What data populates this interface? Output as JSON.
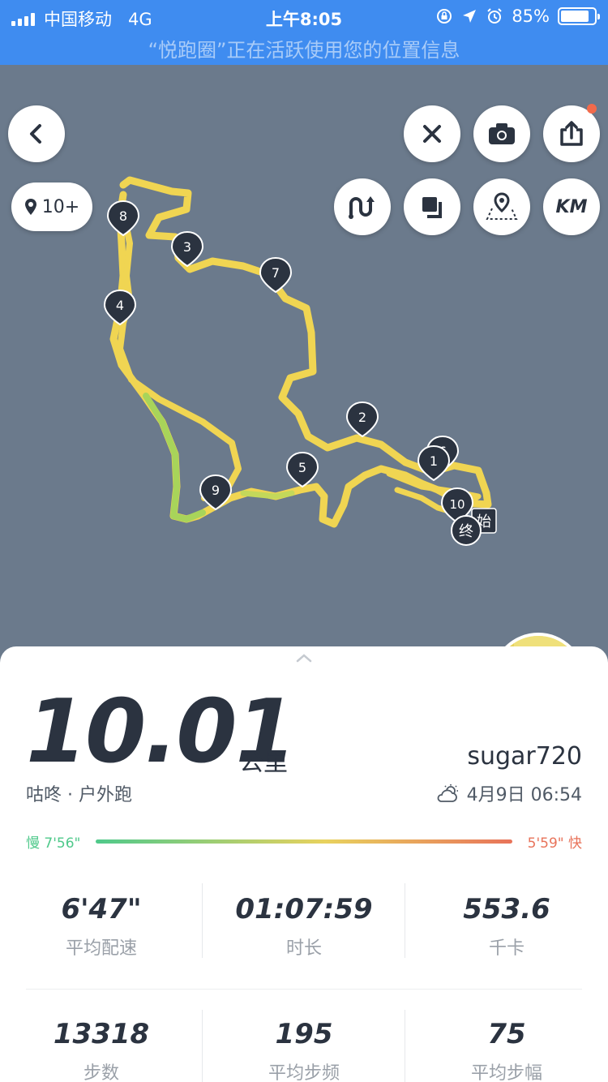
{
  "status_bar": {
    "carrier": "中国移动",
    "network": "4G",
    "time": "上午8:05",
    "battery": "85%",
    "battery_level": 0.85,
    "location_message": "“悦跑圈”正在活跃使用您的位置信息"
  },
  "map": {
    "location_count": "10+",
    "markers": [
      "1",
      "2",
      "3",
      "4",
      "5",
      "6",
      "7",
      "8",
      "9",
      "10"
    ],
    "start_label": "始",
    "end_label": "终",
    "unit_toggle": "KM"
  },
  "run": {
    "distance": "10.01",
    "unit": "公里",
    "source": "咕咚 · 户外跑",
    "username": "sugar720",
    "datetime": "4月9日 06:54"
  },
  "pace_bar": {
    "slow_label": "慢 7'56\"",
    "fast_label": "5'59\" 快"
  },
  "stats": [
    {
      "value": "6'47\"",
      "label": "平均配速"
    },
    {
      "value": "01:07:59",
      "label": "时长"
    },
    {
      "value": "553.6",
      "label": "千卡"
    },
    {
      "value": "13318",
      "label": "步数"
    },
    {
      "value": "195",
      "label": "平均步频"
    },
    {
      "value": "75",
      "label": "平均步幅"
    }
  ],
  "colors": {
    "status_bar": "#3f8cf0",
    "map_bg": "#6b7a8c",
    "route": "#f0d552",
    "route_slow": "#a8d45a",
    "marker": "#2b3340",
    "text_dark": "#2b3340"
  }
}
